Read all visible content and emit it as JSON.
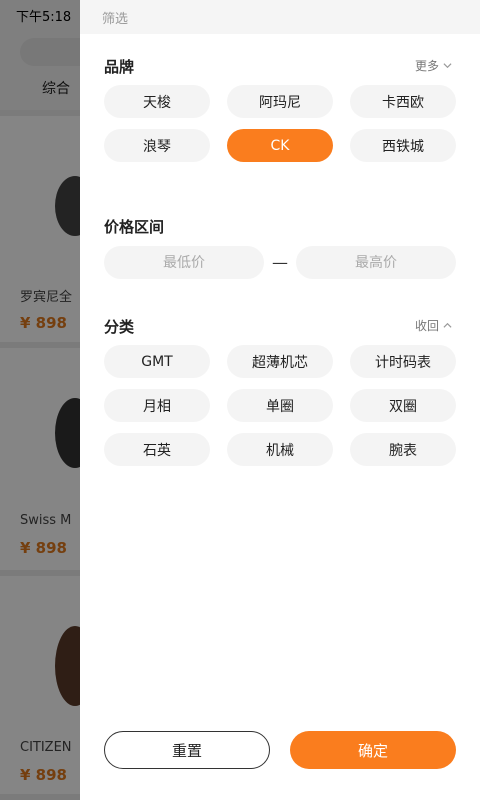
{
  "status_bar": {
    "time": "下午5:18"
  },
  "background": {
    "sort_label": "综合",
    "products": [
      {
        "name": "罗宾尼全",
        "price": "¥ 898"
      },
      {
        "name": "Swiss M",
        "price": "¥ 898"
      },
      {
        "name": "CITIZEN",
        "price": "¥ 898"
      }
    ]
  },
  "drawer": {
    "header_title": "筛选",
    "brand": {
      "title": "品牌",
      "toggle_label": "更多",
      "items": [
        "天梭",
        "阿玛尼",
        "卡西欧",
        "浪琴",
        "CK",
        "西铁城"
      ],
      "selected": "CK"
    },
    "price": {
      "title": "价格区间",
      "min_placeholder": "最低价",
      "max_placeholder": "最高价",
      "separator": "—"
    },
    "category": {
      "title": "分类",
      "toggle_label": "收回",
      "items": [
        "GMT",
        "超薄机芯",
        "计时码表",
        "月相",
        "单圈",
        "双圈",
        "石英",
        "机械",
        "腕表"
      ]
    },
    "reset_label": "重置",
    "confirm_label": "确定"
  },
  "colors": {
    "accent": "#fa7d1e",
    "price_text": "#e07a1e",
    "chip_bg": "#f4f4f4"
  },
  "icons": {
    "more_toggle": "chevron-down-icon",
    "collapse_toggle": "chevron-up-icon"
  }
}
